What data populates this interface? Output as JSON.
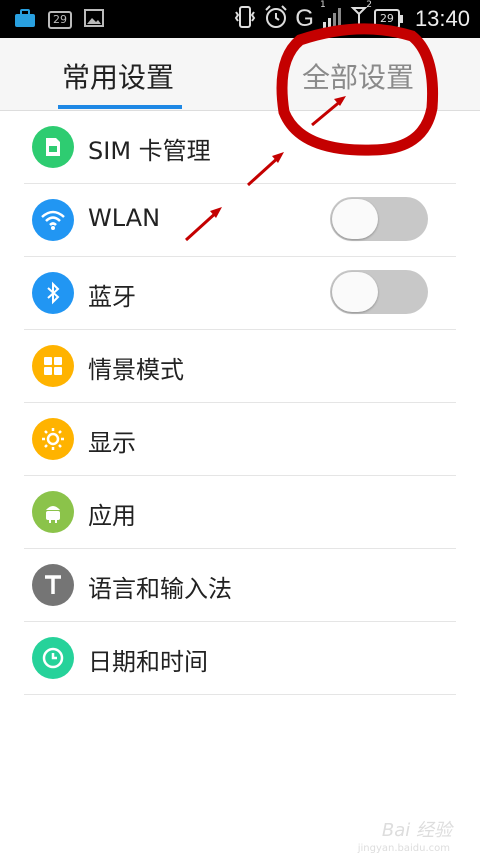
{
  "status_bar": {
    "badge_left": "29",
    "network": "G",
    "sim1": "1",
    "sim2": "2",
    "battery": "29",
    "time": "13:40"
  },
  "tabs": [
    {
      "label": "常用设置",
      "selected": true
    },
    {
      "label": "全部设置",
      "selected": false
    }
  ],
  "settings": [
    {
      "label": "SIM 卡管理",
      "icon": "sim-card-icon",
      "color": "#2ecc71"
    },
    {
      "label": "WLAN",
      "icon": "wifi-icon",
      "color": "#2196f3",
      "toggle": false
    },
    {
      "label": "蓝牙",
      "icon": "bluetooth-icon",
      "color": "#2196f3",
      "toggle": false
    },
    {
      "label": "情景模式",
      "icon": "grid-icon",
      "color": "#ffb300"
    },
    {
      "label": "显示",
      "icon": "brightness-icon",
      "color": "#ffb300"
    },
    {
      "label": "应用",
      "icon": "android-icon",
      "color": "#8bc34a"
    },
    {
      "label": "语言和输入法",
      "icon": "text-t-icon",
      "color": "#757575"
    },
    {
      "label": "日期和时间",
      "icon": "clock-icon",
      "color": "#26d29a"
    }
  ],
  "annotation_color": "#c40000",
  "watermark": {
    "text": "Bai 经验",
    "sub": "jingyan.baidu.com"
  }
}
